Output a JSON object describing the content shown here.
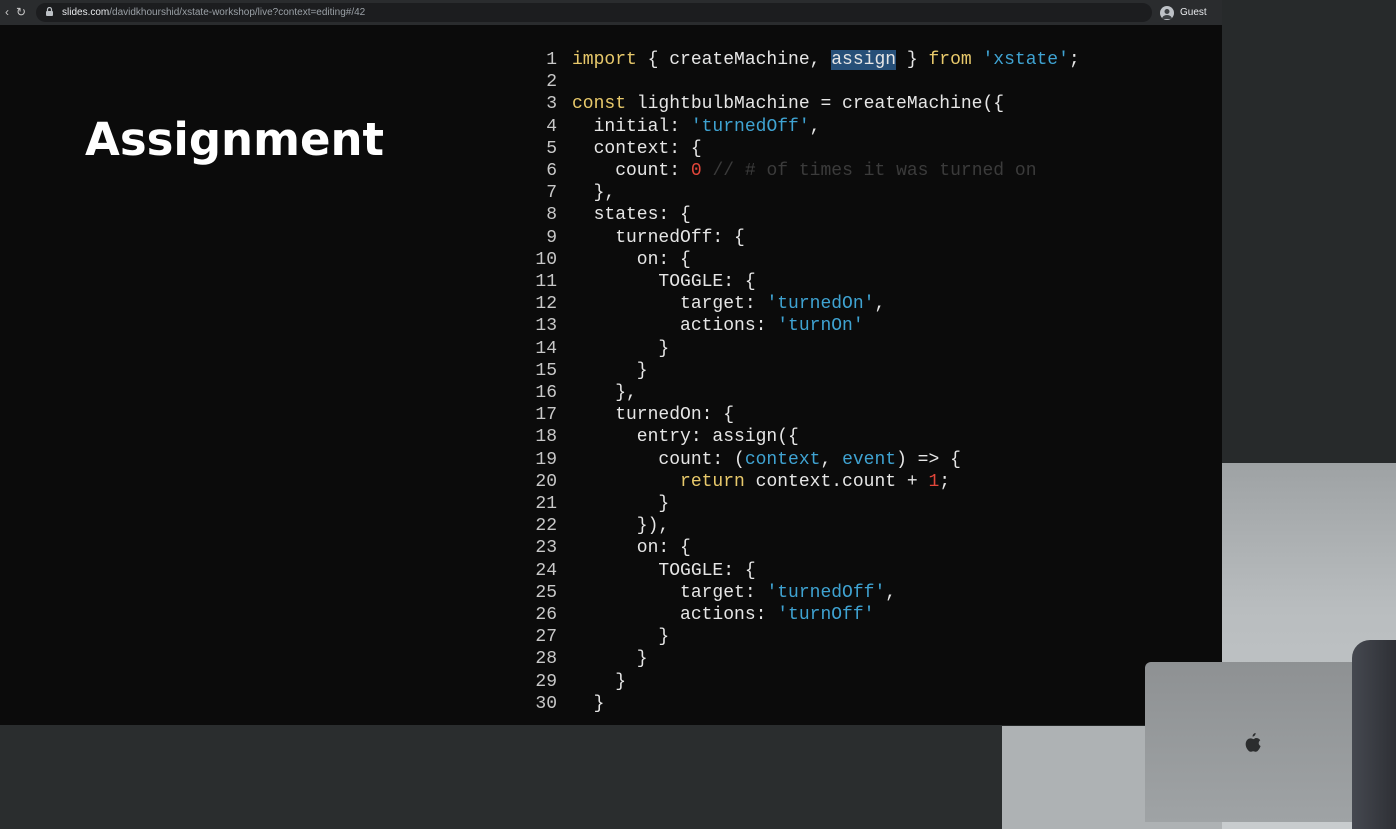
{
  "browser": {
    "url_host": "slides.com",
    "url_path": "/davidkhourshid/xstate-workshop/live?context=editing#/42",
    "profile_label": "Guest"
  },
  "slide": {
    "title": "Assignment"
  },
  "code": {
    "lines": [
      {
        "n": "1",
        "parts": [
          {
            "t": "import",
            "c": "kw"
          },
          {
            "t": " { createMachine, "
          },
          {
            "t": "assign",
            "c": "sel"
          },
          {
            "t": " } "
          },
          {
            "t": "from",
            "c": "kw"
          },
          {
            "t": " "
          },
          {
            "t": "'xstate'",
            "c": "str"
          },
          {
            "t": ";"
          }
        ]
      },
      {
        "n": "2",
        "parts": []
      },
      {
        "n": "3",
        "parts": [
          {
            "t": "const",
            "c": "kw"
          },
          {
            "t": " lightbulbMachine = createMachine({"
          }
        ]
      },
      {
        "n": "4",
        "parts": [
          {
            "t": "  initial: "
          },
          {
            "t": "'turnedOff'",
            "c": "str"
          },
          {
            "t": ","
          }
        ]
      },
      {
        "n": "5",
        "parts": [
          {
            "t": "  context: {"
          }
        ]
      },
      {
        "n": "6",
        "parts": [
          {
            "t": "    count: "
          },
          {
            "t": "0",
            "c": "num"
          },
          {
            "t": " "
          },
          {
            "t": "// # of times it was turned on",
            "c": "com"
          }
        ]
      },
      {
        "n": "7",
        "parts": [
          {
            "t": "  },"
          }
        ]
      },
      {
        "n": "8",
        "parts": [
          {
            "t": "  states: {"
          }
        ]
      },
      {
        "n": "9",
        "parts": [
          {
            "t": "    turnedOff: {"
          }
        ]
      },
      {
        "n": "10",
        "parts": [
          {
            "t": "      on: {"
          }
        ]
      },
      {
        "n": "11",
        "parts": [
          {
            "t": "        TOGGLE: {"
          }
        ]
      },
      {
        "n": "12",
        "parts": [
          {
            "t": "          target: "
          },
          {
            "t": "'turnedOn'",
            "c": "str"
          },
          {
            "t": ","
          }
        ]
      },
      {
        "n": "13",
        "parts": [
          {
            "t": "          actions: "
          },
          {
            "t": "'turnOn'",
            "c": "str"
          }
        ]
      },
      {
        "n": "14",
        "parts": [
          {
            "t": "        }"
          }
        ]
      },
      {
        "n": "15",
        "parts": [
          {
            "t": "      }"
          }
        ]
      },
      {
        "n": "16",
        "parts": [
          {
            "t": "    },"
          }
        ]
      },
      {
        "n": "17",
        "parts": [
          {
            "t": "    turnedOn: {"
          }
        ]
      },
      {
        "n": "18",
        "parts": [
          {
            "t": "      entry: assign({"
          }
        ]
      },
      {
        "n": "19",
        "parts": [
          {
            "t": "        count: ("
          },
          {
            "t": "context",
            "c": "par"
          },
          {
            "t": ", "
          },
          {
            "t": "event",
            "c": "par"
          },
          {
            "t": ") => {"
          }
        ]
      },
      {
        "n": "20",
        "parts": [
          {
            "t": "          "
          },
          {
            "t": "return",
            "c": "kw"
          },
          {
            "t": " context.count + "
          },
          {
            "t": "1",
            "c": "num"
          },
          {
            "t": ";"
          }
        ]
      },
      {
        "n": "21",
        "parts": [
          {
            "t": "        }"
          }
        ]
      },
      {
        "n": "22",
        "parts": [
          {
            "t": "      }),"
          }
        ]
      },
      {
        "n": "23",
        "parts": [
          {
            "t": "      on: {"
          }
        ]
      },
      {
        "n": "24",
        "parts": [
          {
            "t": "        TOGGLE: {"
          }
        ]
      },
      {
        "n": "25",
        "parts": [
          {
            "t": "          target: "
          },
          {
            "t": "'turnedOff'",
            "c": "str"
          },
          {
            "t": ","
          }
        ]
      },
      {
        "n": "26",
        "parts": [
          {
            "t": "          actions: "
          },
          {
            "t": "'turnOff'",
            "c": "str"
          }
        ]
      },
      {
        "n": "27",
        "parts": [
          {
            "t": "        }"
          }
        ]
      },
      {
        "n": "28",
        "parts": [
          {
            "t": "      }"
          }
        ]
      },
      {
        "n": "29",
        "parts": [
          {
            "t": "    }"
          }
        ]
      },
      {
        "n": "30",
        "parts": [
          {
            "t": "  }"
          }
        ]
      }
    ]
  },
  "colors": {
    "keyword": "#e8c96b",
    "string": "#3fa3d2",
    "number": "#e2463a",
    "comment": "#3b3b3b",
    "selection": "#264f78"
  }
}
